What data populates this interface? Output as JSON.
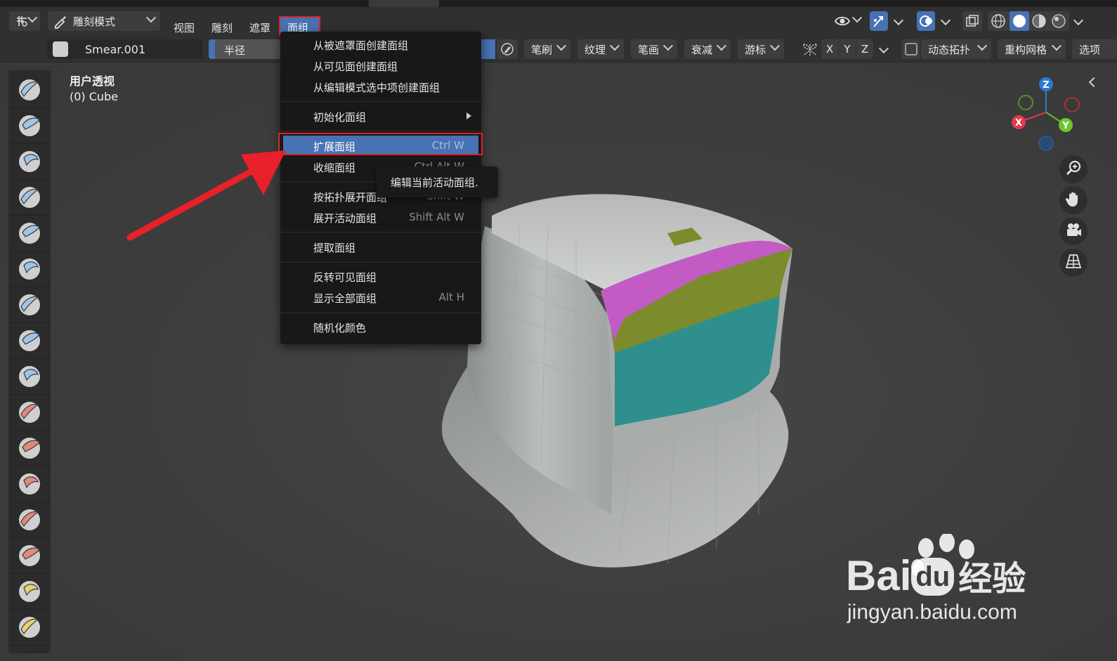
{
  "header": {
    "mode_label": "雕刻模式",
    "menus": [
      "视图",
      "雕刻",
      "遮罩"
    ],
    "active_menu": "面组"
  },
  "toolsettings": {
    "brush_name": "Smear.001",
    "radius_label": "半径",
    "dropdowns": [
      "笔刷",
      "纹理",
      "笔画",
      "衰减",
      "游标"
    ],
    "axes": [
      "X",
      "Y",
      "Z"
    ],
    "dyntopo": "动态拓扑",
    "remesh": "重构网格",
    "options": "选项"
  },
  "viewport": {
    "view_name": "用户透视",
    "object_name": "(0) Cube",
    "gizmo": {
      "z": "Z",
      "x": "X",
      "y": "Y"
    }
  },
  "menu": {
    "items": [
      {
        "label": "从被遮罩面创建面组",
        "shortcut": ""
      },
      {
        "label": "从可见面创建面组",
        "shortcut": ""
      },
      {
        "label": "从编辑模式选中项创建面组",
        "shortcut": ""
      },
      {
        "label": "初始化面组",
        "shortcut": "",
        "submenu": true
      },
      {
        "label": "扩展面组",
        "shortcut": "Ctrl W",
        "selected": true
      },
      {
        "label": "收缩面组",
        "shortcut": "Ctrl Alt W"
      },
      {
        "label": "按拓扑展开面组",
        "shortcut": "Shift W"
      },
      {
        "label": "展开活动面组",
        "shortcut": "Shift Alt W"
      },
      {
        "label": "提取面组",
        "shortcut": ""
      },
      {
        "label": "反转可见面组",
        "shortcut": ""
      },
      {
        "label": "显示全部面组",
        "shortcut": "Alt H"
      },
      {
        "label": "随机化颜色",
        "shortcut": ""
      }
    ]
  },
  "tooltip": "编辑当前活动面组.",
  "watermark": {
    "brand_latin": "Bai",
    "brand_du": "du",
    "brand_cn": "经验",
    "url": "jingyan.baidu.com"
  },
  "colors": {
    "accent": "#4772b3",
    "highlight_red": "#e0222b",
    "arrow_red": "#e8202a",
    "facesets": [
      "#c35bc4",
      "#7c8c2c",
      "#2f8f8c"
    ]
  }
}
